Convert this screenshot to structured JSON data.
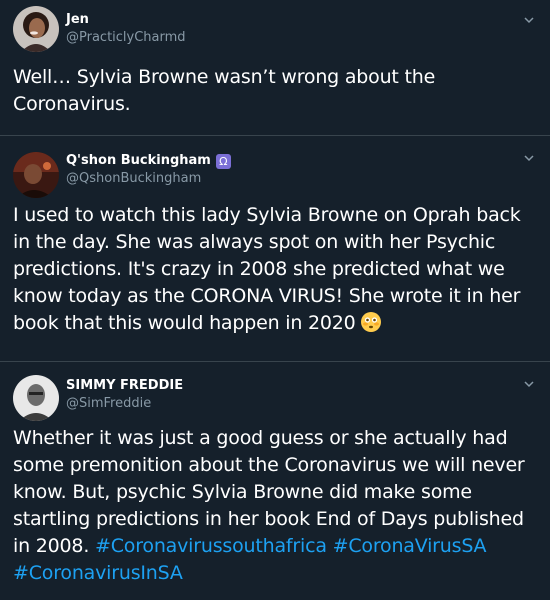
{
  "tweets": [
    {
      "display_name": "Jen",
      "handle": "@PracticlyCharmd",
      "text": "Well… Sylvia Browne wasn’t wrong about the Coronavirus."
    },
    {
      "display_name": "Q'shon Buckingham",
      "handle": "@QshonBuckingham",
      "badge_icon": "omega-badge-icon",
      "badge_glyph": "Ω",
      "text": "I used to watch this lady Sylvia Browne on Oprah back in the day. She was always spot on with her Psychic predictions. It's crazy in 2008 she predicted what we know today as the CORONA VIRUS! She wrote it in her book that this would happen in 2020",
      "emoji": "flushed-face-emoji"
    },
    {
      "display_name": "SIMMY FREDDIE",
      "handle": "@SimFreddie",
      "text_before_tags": "Whether it was just a good guess or she actually had some premonition about the Coronavirus we will never know. But, psychic Sylvia Browne did make some startling predictions in her book End of Days published in 2008. ",
      "hashtags": [
        "#Coronavirussouthafrica",
        "#CoronaVirusSA",
        "#CoronavirusInSA"
      ]
    }
  ],
  "colors": {
    "background": "#15202b",
    "text": "#ffffff",
    "secondary": "#8899a6",
    "hashtag": "#1da1f2",
    "divider": "#38444d"
  },
  "icons": {
    "menu": "chevron-down-icon"
  }
}
